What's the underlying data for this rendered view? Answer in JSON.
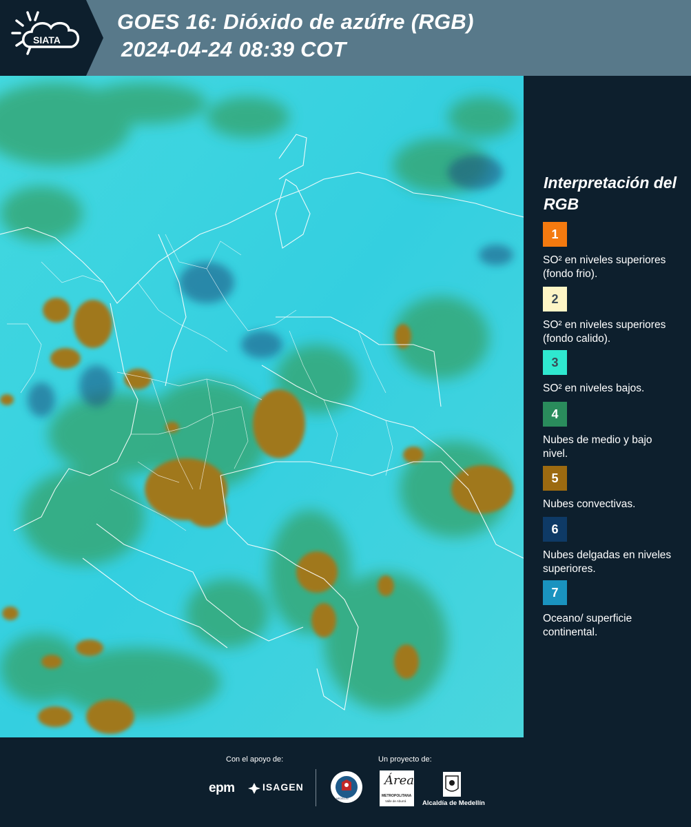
{
  "header": {
    "logo_text": "SIATA",
    "title_line1": "GOES 16: Dióxido de azúfre (RGB)",
    "title_line2": "2024-04-24 08:39 COT",
    "background": "#58798a",
    "logo_background": "#0d1f2d"
  },
  "map": {
    "background_color": "#3ed4dc",
    "border_color": "#ffffff",
    "layer_icons": [
      "satellite-rgb-imagery",
      "country-borders",
      "department-borders"
    ]
  },
  "legend": {
    "title": "Interpretación del RGB",
    "items": [
      {
        "number": "1",
        "label": "SO² en niveles superiores (fondo frio).",
        "color": "#f47a0f"
      },
      {
        "number": "2",
        "label": "SO² en niveles superiores (fondo calido).",
        "color": "#fdf5c5"
      },
      {
        "number": "3",
        "label": "SO² en niveles bajos.",
        "color": "#2fe8cf"
      },
      {
        "number": "4",
        "label": "Nubes de medio y bajo nivel.",
        "color": "#2a8c5c"
      },
      {
        "number": "5",
        "label": "Nubes convectivas.",
        "color": "#9c6a10"
      },
      {
        "number": "6",
        "label": "Nubes delgadas en niveles superiores.",
        "color": "#0e3a66"
      },
      {
        "number": "7",
        "label": "Oceano/ superficie continental.",
        "color": "#1a93bf"
      }
    ]
  },
  "footer": {
    "support_caption": "Con el apoyo de:",
    "project_caption": "Un proyecto de:",
    "sponsor1": "epm",
    "sponsor2": "ISAGEN",
    "seal_text": "MEDELLÍN",
    "area_name": "Área",
    "area_sub": "METROPOLITANA",
    "area_sub2": "Valle de Aburrá",
    "alcaldia": "Alcaldía de Medellín"
  }
}
